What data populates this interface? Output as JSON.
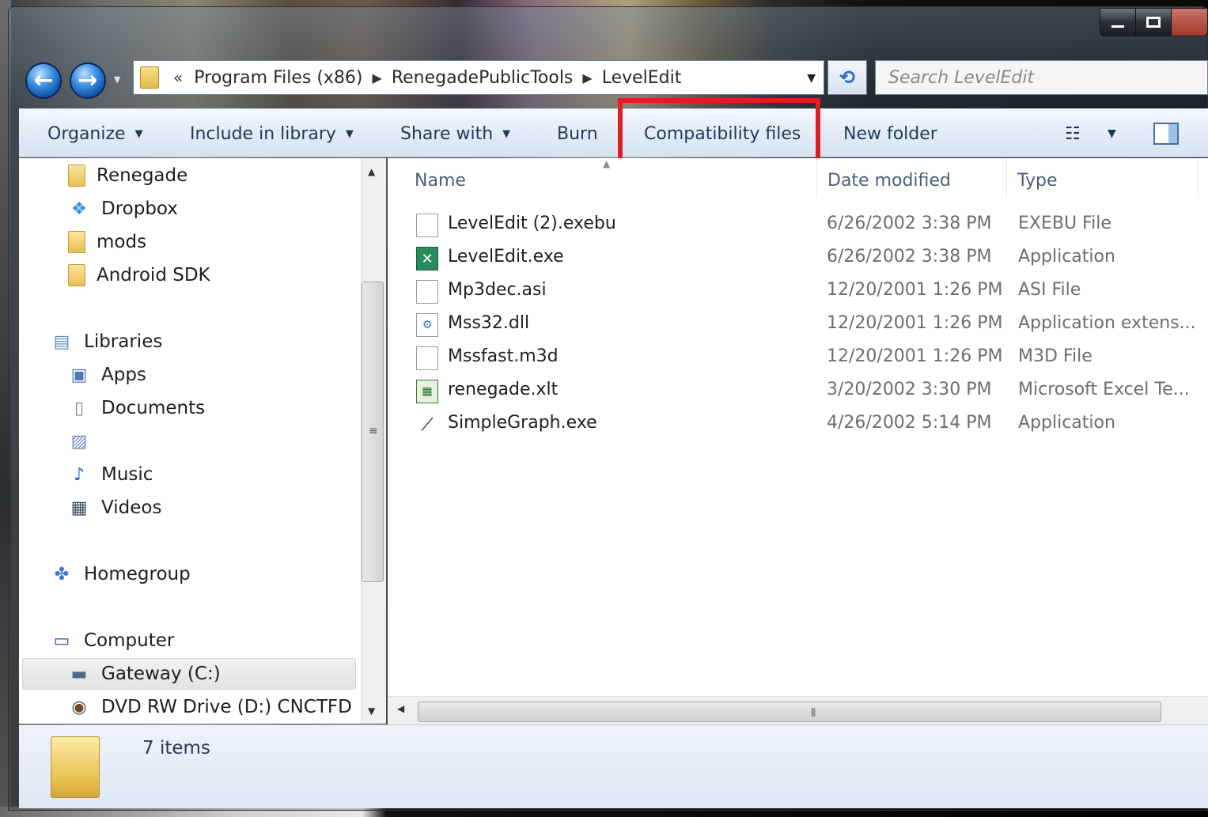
{
  "window": {
    "controls": {
      "minimize": "minimize",
      "maximize": "maximize"
    }
  },
  "navigation": {
    "back_icon": "back-arrow-icon",
    "forward_icon": "forward-arrow-icon",
    "address": {
      "overflow": "«",
      "segments": [
        "Program Files (x86)",
        "RenegadePublicTools",
        "LevelEdit"
      ]
    },
    "search_placeholder": "Search LevelEdit"
  },
  "toolbar": {
    "organize": "Organize",
    "include_in_library": "Include in library",
    "share_with": "Share with",
    "burn": "Burn",
    "compatibility_files": "Compatibility files",
    "new_folder": "New folder"
  },
  "annotation": {
    "highlight_color": "#e11d24"
  },
  "nav_pane": {
    "favorites": [
      {
        "label": "Renegade",
        "icon": "folder-icon"
      },
      {
        "label": "Dropbox",
        "icon": "dropbox-icon"
      },
      {
        "label": "mods",
        "icon": "folder-icon"
      },
      {
        "label": "Android SDK",
        "icon": "folder-icon"
      }
    ],
    "libraries": {
      "label": "Libraries",
      "items": [
        {
          "label": "Apps",
          "icon": "apps-library-icon"
        },
        {
          "label": "Documents",
          "icon": "documents-icon"
        },
        {
          "label": "",
          "icon": "pictures-icon"
        },
        {
          "label": "Music",
          "icon": "music-icon"
        },
        {
          "label": "Videos",
          "icon": "videos-icon"
        }
      ]
    },
    "homegroup": "Homegroup",
    "computer": {
      "label": "Computer",
      "drives": [
        {
          "label": "Gateway (C:)",
          "icon": "hard-drive-icon",
          "selected": true
        },
        {
          "label": "DVD RW Drive (D:) CNCTFD",
          "icon": "dvd-drive-icon",
          "selected": false
        }
      ]
    }
  },
  "file_list": {
    "columns": {
      "name": "Name",
      "date_modified": "Date modified",
      "type": "Type"
    },
    "rows": [
      {
        "name": "LevelEdit (2).exebu",
        "date": "6/26/2002 3:38 PM",
        "type": "EXEBU File",
        "icon": "generic-file-icon"
      },
      {
        "name": "LevelEdit.exe",
        "date": "6/26/2002 3:38 PM",
        "type": "Application",
        "icon": "tools-app-icon"
      },
      {
        "name": "Mp3dec.asi",
        "date": "12/20/2001 1:26 PM",
        "type": "ASI File",
        "icon": "generic-file-icon"
      },
      {
        "name": "Mss32.dll",
        "date": "12/20/2001 1:26 PM",
        "type": "Application extens...",
        "icon": "dll-file-icon"
      },
      {
        "name": "Mssfast.m3d",
        "date": "12/20/2001 1:26 PM",
        "type": "M3D File",
        "icon": "generic-file-icon"
      },
      {
        "name": "renegade.xlt",
        "date": "3/20/2002 3:30 PM",
        "type": "Microsoft Excel Te...",
        "icon": "excel-template-icon"
      },
      {
        "name": "SimpleGraph.exe",
        "date": "4/26/2002 5:14 PM",
        "type": "Application",
        "icon": "graph-app-icon"
      }
    ]
  },
  "details_pane": {
    "item_count": "7 items"
  }
}
